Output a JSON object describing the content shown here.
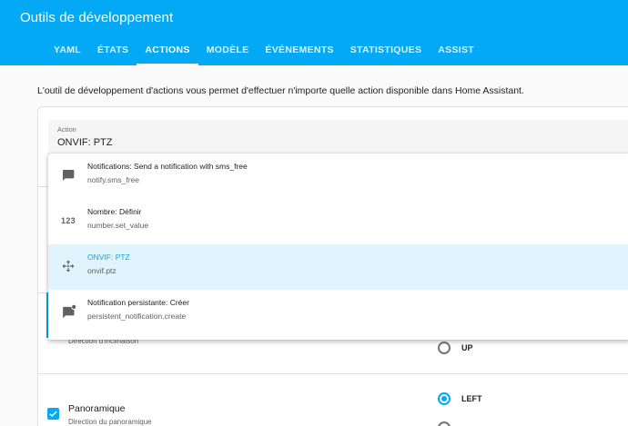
{
  "header": {
    "title": "Outils de développement",
    "tabs": [
      {
        "label": "YAML",
        "active": false
      },
      {
        "label": "ÉTATS",
        "active": false
      },
      {
        "label": "ACTIONS",
        "active": true
      },
      {
        "label": "MODÈLE",
        "active": false
      },
      {
        "label": "ÉVÉNEMENTS",
        "active": false
      },
      {
        "label": "STATISTIQUES",
        "active": false
      },
      {
        "label": "ASSIST",
        "active": false
      }
    ]
  },
  "intro": "L'outil de développement d'actions vous permet d'effectuer n'importe quelle action disponible dans Home Assistant.",
  "action_field": {
    "label": "Action",
    "value": "ONVIF: PTZ"
  },
  "dropdown": {
    "options": [
      {
        "title": "Notifications: Send a notification with sms_free",
        "id": "notify.sms_free",
        "icon": "message-icon",
        "selected": false
      },
      {
        "title": "Nombre: Définir",
        "id": "number.set_value",
        "icon": "numeric-icon",
        "icon_text": "123",
        "selected": false
      },
      {
        "title": "ONVIF: PTZ",
        "id": "onvif.ptz",
        "icon": "pan-arrows-icon",
        "selected": true
      },
      {
        "title": "Notification persistante: Créer",
        "id": "persistent_notification.create",
        "icon": "message-badge-icon",
        "selected": false
      }
    ]
  },
  "form": {
    "tilt_description": "Direction d'inclinaison",
    "tilt_option": "UP",
    "pan_title": "Panoramique",
    "pan_description": "Direction du panoramique",
    "pan_option": "LEFT",
    "pan_checked": true
  },
  "colors": {
    "primary": "#03a9f4",
    "selected_bg": "#e1f3fd"
  }
}
